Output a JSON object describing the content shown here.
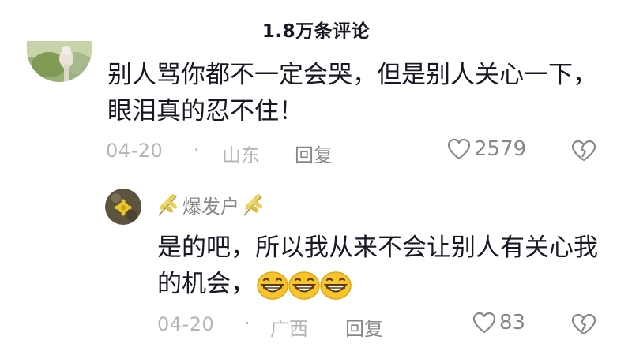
{
  "header": {
    "title": "1.8万条评论"
  },
  "comment": {
    "text": "别人骂你都不一定会哭，但是别人关心一下，眼泪真的忍不住！",
    "date": "04-20",
    "location": "山东",
    "reply_label": "回复",
    "likes": "2579",
    "icons": {
      "like": "heart-outline-icon",
      "dislike": "broken-heart-icon"
    }
  },
  "reply": {
    "username": "爆发户",
    "text": "是的吧，所以我从来不会让别人有关心我的机会，",
    "emoji_icon": "grinning-face-emoji",
    "emoji_count": 3,
    "date": "04-20",
    "location": "广西",
    "reply_label": "回复",
    "likes": "83",
    "name_decoration_icon": "wheat-ear-icon"
  },
  "colors": {
    "text_primary": "#161823",
    "text_secondary": "#86878b",
    "text_tertiary": "#b5b5b9",
    "background": "#ffffff"
  }
}
